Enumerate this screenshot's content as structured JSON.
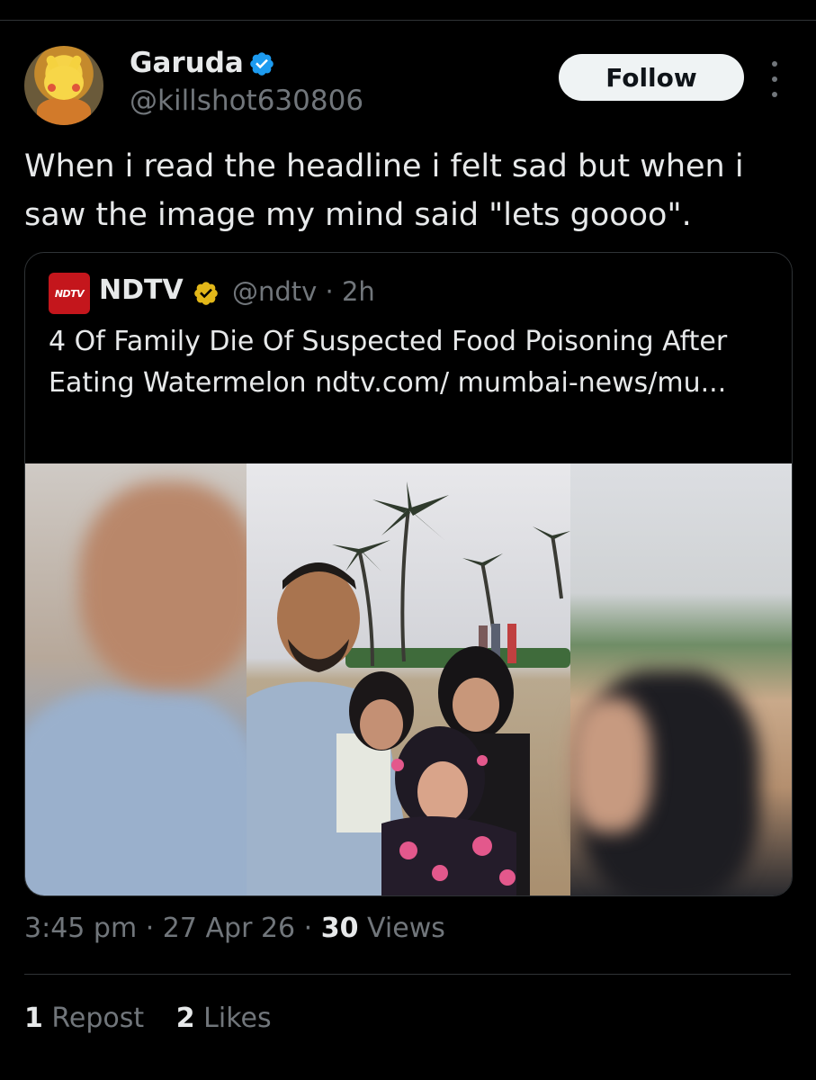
{
  "author": {
    "name": "Garuda",
    "handle": "@killshot630806",
    "avatar_icon": "pikachu-avatar"
  },
  "follow_label": "Follow",
  "tweet_text": "When i read the headline i felt sad but when i saw the image my mind said \"lets goooo\".",
  "quoted": {
    "logo_text": "NDTV",
    "name": "NDTV",
    "handle_time": "@ndtv · 2h",
    "text": "4 Of Family Die Of Suspected Food Poisoning After Eating Watermelon ndtv.com/ mumbai-news/mu..."
  },
  "meta": {
    "time": "3:45 pm",
    "date": "27 Apr 26",
    "views_count": "30",
    "views_label": "Views"
  },
  "stats": {
    "reposts_count": "1",
    "reposts_label": "Repost",
    "likes_count": "2",
    "likes_label": "Likes"
  },
  "colors": {
    "background": "#000000",
    "verified_blue": "#1d9bf0",
    "verified_gold": "#e2b719",
    "ndtv_red": "#c4161c"
  }
}
